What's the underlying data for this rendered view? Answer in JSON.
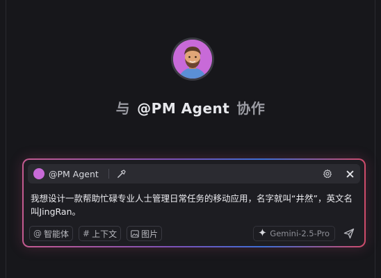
{
  "header": {
    "title_prefix": "与",
    "title_agent": "@PM Agent",
    "title_suffix": "协作",
    "avatar_icon": "avatar-man-beard"
  },
  "composer": {
    "agent_label": "@PM Agent",
    "message_text": "我想设计一款帮助忙碌专业人士管理日常任务的移动应用，名字就叫“井然”，英文名叫JingRan。",
    "chips": [
      {
        "icon": "@",
        "label": "智能体"
      },
      {
        "icon": "#",
        "label": "上下文"
      },
      {
        "icon": "image-icon",
        "label": "图片"
      }
    ],
    "model_label": "Gemini-2.5-Pro"
  },
  "colors": {
    "background": "#17171b",
    "composer_bg": "#1d1d22",
    "avatar_bg": "#c86ad8",
    "gradient_pink": "#c45a90",
    "gradient_blue": "#3e6fd8"
  }
}
